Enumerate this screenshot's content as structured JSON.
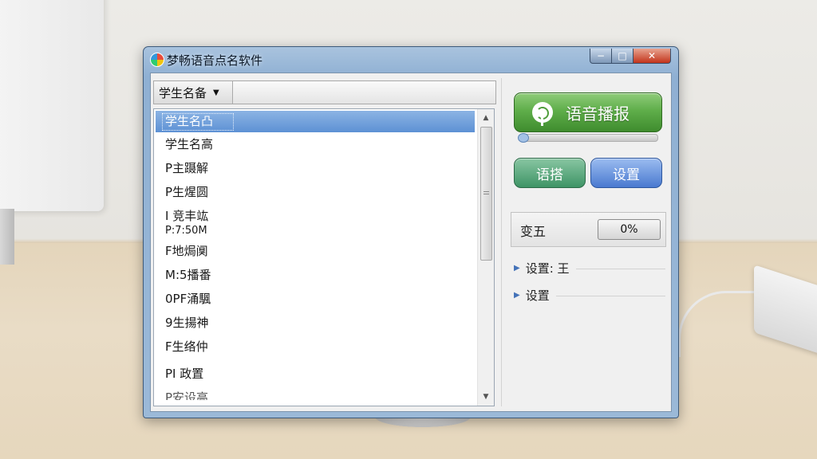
{
  "window": {
    "title": "梦畅语音点名软件",
    "controls": {
      "minimize": "−",
      "maximize": "□",
      "close": "✕"
    }
  },
  "left_panel": {
    "combo": {
      "selected": "学生名备",
      "arrow": "▼"
    },
    "list": {
      "items": [
        "学生名凸",
        "学生名高",
        "P主蹑解",
        "P生煋圆",
        "I 竞丰竑",
        "P:7:50M",
        "F地焗阒",
        "M:5播番",
        "0PF涌颿",
        "9生揚神",
        "F生络仲",
        "PI 政置",
        "P安设高"
      ],
      "selected_index": 0
    },
    "scrollbar": {
      "up": "▲",
      "down": "▼"
    }
  },
  "right_panel": {
    "speak_button": {
      "label": "语音播报",
      "icon": "microphone-icon"
    },
    "volume_slider": {
      "value": 0.0
    },
    "voice_button": {
      "label": "语搭"
    },
    "settings_button": {
      "label": "设置"
    },
    "progress": {
      "label": "变五",
      "value": "0%"
    },
    "expanders": [
      {
        "label": "设置: 王",
        "arrow": "▶"
      },
      {
        "label": "设置",
        "arrow": "▶"
      }
    ]
  },
  "colors": {
    "speak_green": "#5fae4a",
    "voice_teal": "#3f9466",
    "settings_blue": "#4a7ad0",
    "selection_blue": "#5d91d4"
  }
}
